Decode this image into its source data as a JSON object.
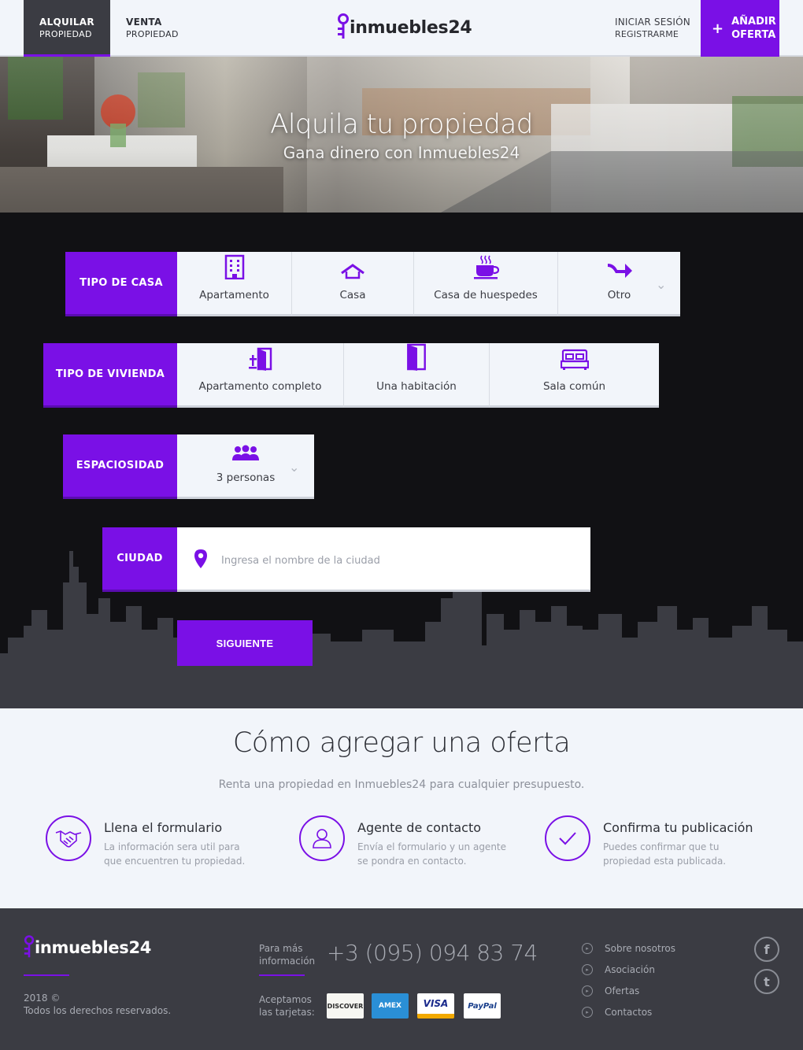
{
  "header": {
    "tabs": [
      {
        "line1": "ALQUILAR",
        "line2": "PROPIEDAD"
      },
      {
        "line1": "VENTA",
        "line2": "PROPIEDAD"
      }
    ],
    "logo": "inmuebles24",
    "login": "INICIAR SESIÓN",
    "register": "REGISTRARME",
    "add_offer": {
      "plus": "+",
      "line1": "AÑADIR",
      "line2": "OFERTA"
    }
  },
  "hero": {
    "title": "Alquila tu propiedad",
    "subtitle": "Gana dinero con Inmuebles24"
  },
  "form": {
    "house_type": {
      "label": "TIPO DE CASA",
      "options": [
        "Apartamento",
        "Casa",
        "Casa de huespedes",
        "Otro"
      ]
    },
    "dwelling_type": {
      "label": "TIPO DE VIVIENDA",
      "options": [
        "Apartamento completo",
        "Una habitación",
        "Sala común"
      ]
    },
    "capacity": {
      "label": "ESPACIOSIDAD",
      "value": "3 personas"
    },
    "city": {
      "label": "CIUDAD",
      "placeholder": "Ingresa el nombre de la ciudad"
    },
    "next_button": "SIGUIENTE"
  },
  "how": {
    "title": "Cómo agregar una oferta",
    "subtitle": "Renta una propiedad en Inmuebles24 para cualquier presupuesto.",
    "steps": [
      {
        "title": "Llena el formulario",
        "desc": "La información sera util para que encuentren tu propiedad.",
        "icon": "handshake-icon"
      },
      {
        "title": "Agente de contacto",
        "desc": "Envía el formulario y un agente se pondra en contacto.",
        "icon": "user-icon"
      },
      {
        "title": "Confirma tu publicación",
        "desc": "Puedes confirmar que tu propiedad esta publicada.",
        "icon": "check-icon"
      }
    ]
  },
  "footer": {
    "logo": "inmuebles24",
    "copyright_year": "2018 ©",
    "copyright_text": "Todos los derechos reservados.",
    "info_label_1": "Para más",
    "info_label_2": "información",
    "phone": "+3 (095) 094 83 74",
    "cards_label_1": "Aceptamos",
    "cards_label_2": "las tarjetas:",
    "cards": [
      "DISCOVER",
      "AMEX",
      "VISA",
      "PayPal"
    ],
    "links": [
      "Sobre nosotros",
      "Asociación",
      "Ofertas",
      "Contactos"
    ],
    "social": [
      "f",
      "t"
    ]
  },
  "colors": {
    "accent": "#7a10e6",
    "dark": "#3b3c43",
    "form_bg": "#111114",
    "light": "#f2f5fa"
  }
}
